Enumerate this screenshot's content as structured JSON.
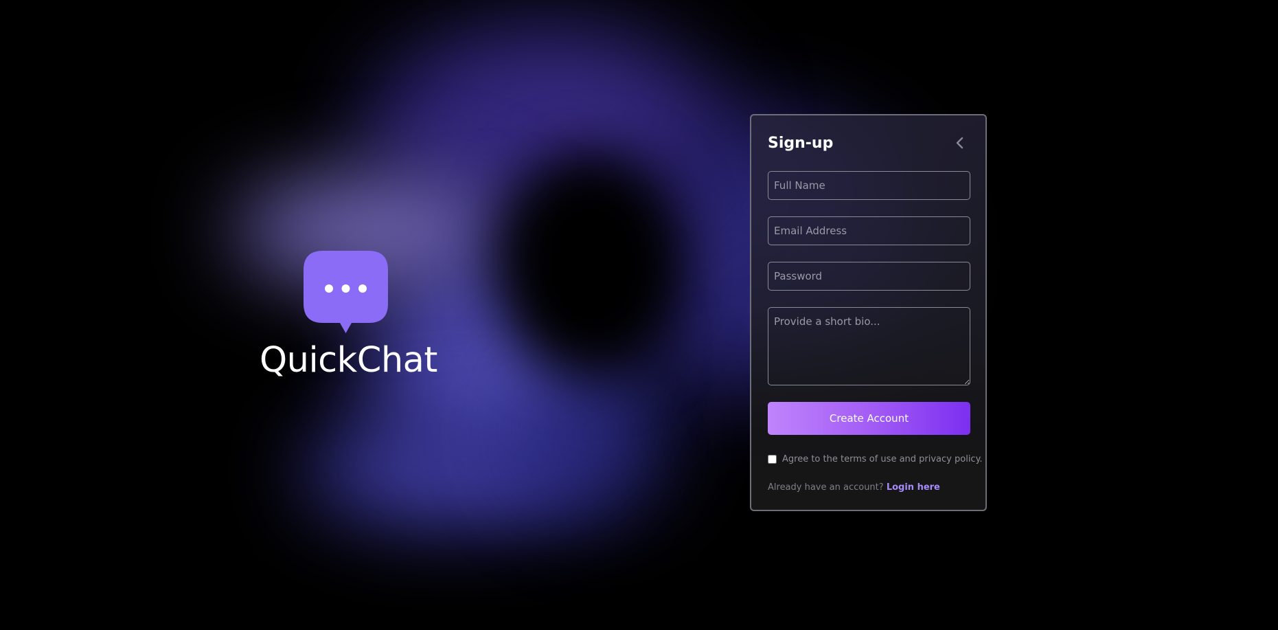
{
  "brand": {
    "name": "QuickChat",
    "logo_icon": "chat-bubble-ellipsis-icon",
    "logo_color": "#8b6cf6"
  },
  "signup": {
    "title": "Sign-up",
    "back_icon": "chevron-left-icon",
    "full_name": {
      "placeholder": "Full Name",
      "value": ""
    },
    "email": {
      "placeholder": "Email Address",
      "value": ""
    },
    "password": {
      "placeholder": "Password",
      "value": ""
    },
    "bio": {
      "placeholder": "Provide a short bio...",
      "value": ""
    },
    "create_button_label": "Create Account",
    "terms_label": "Agree to the terms of use and privacy policy.",
    "terms_checked": false,
    "login_prompt": "Already have an account?",
    "login_link": "Login here"
  },
  "colors": {
    "accent": "#8b5cf6",
    "link": "#a78bfa",
    "button_gradient_start": "#c084fc",
    "button_gradient_end": "#7c2ff0",
    "background": "#000000"
  }
}
